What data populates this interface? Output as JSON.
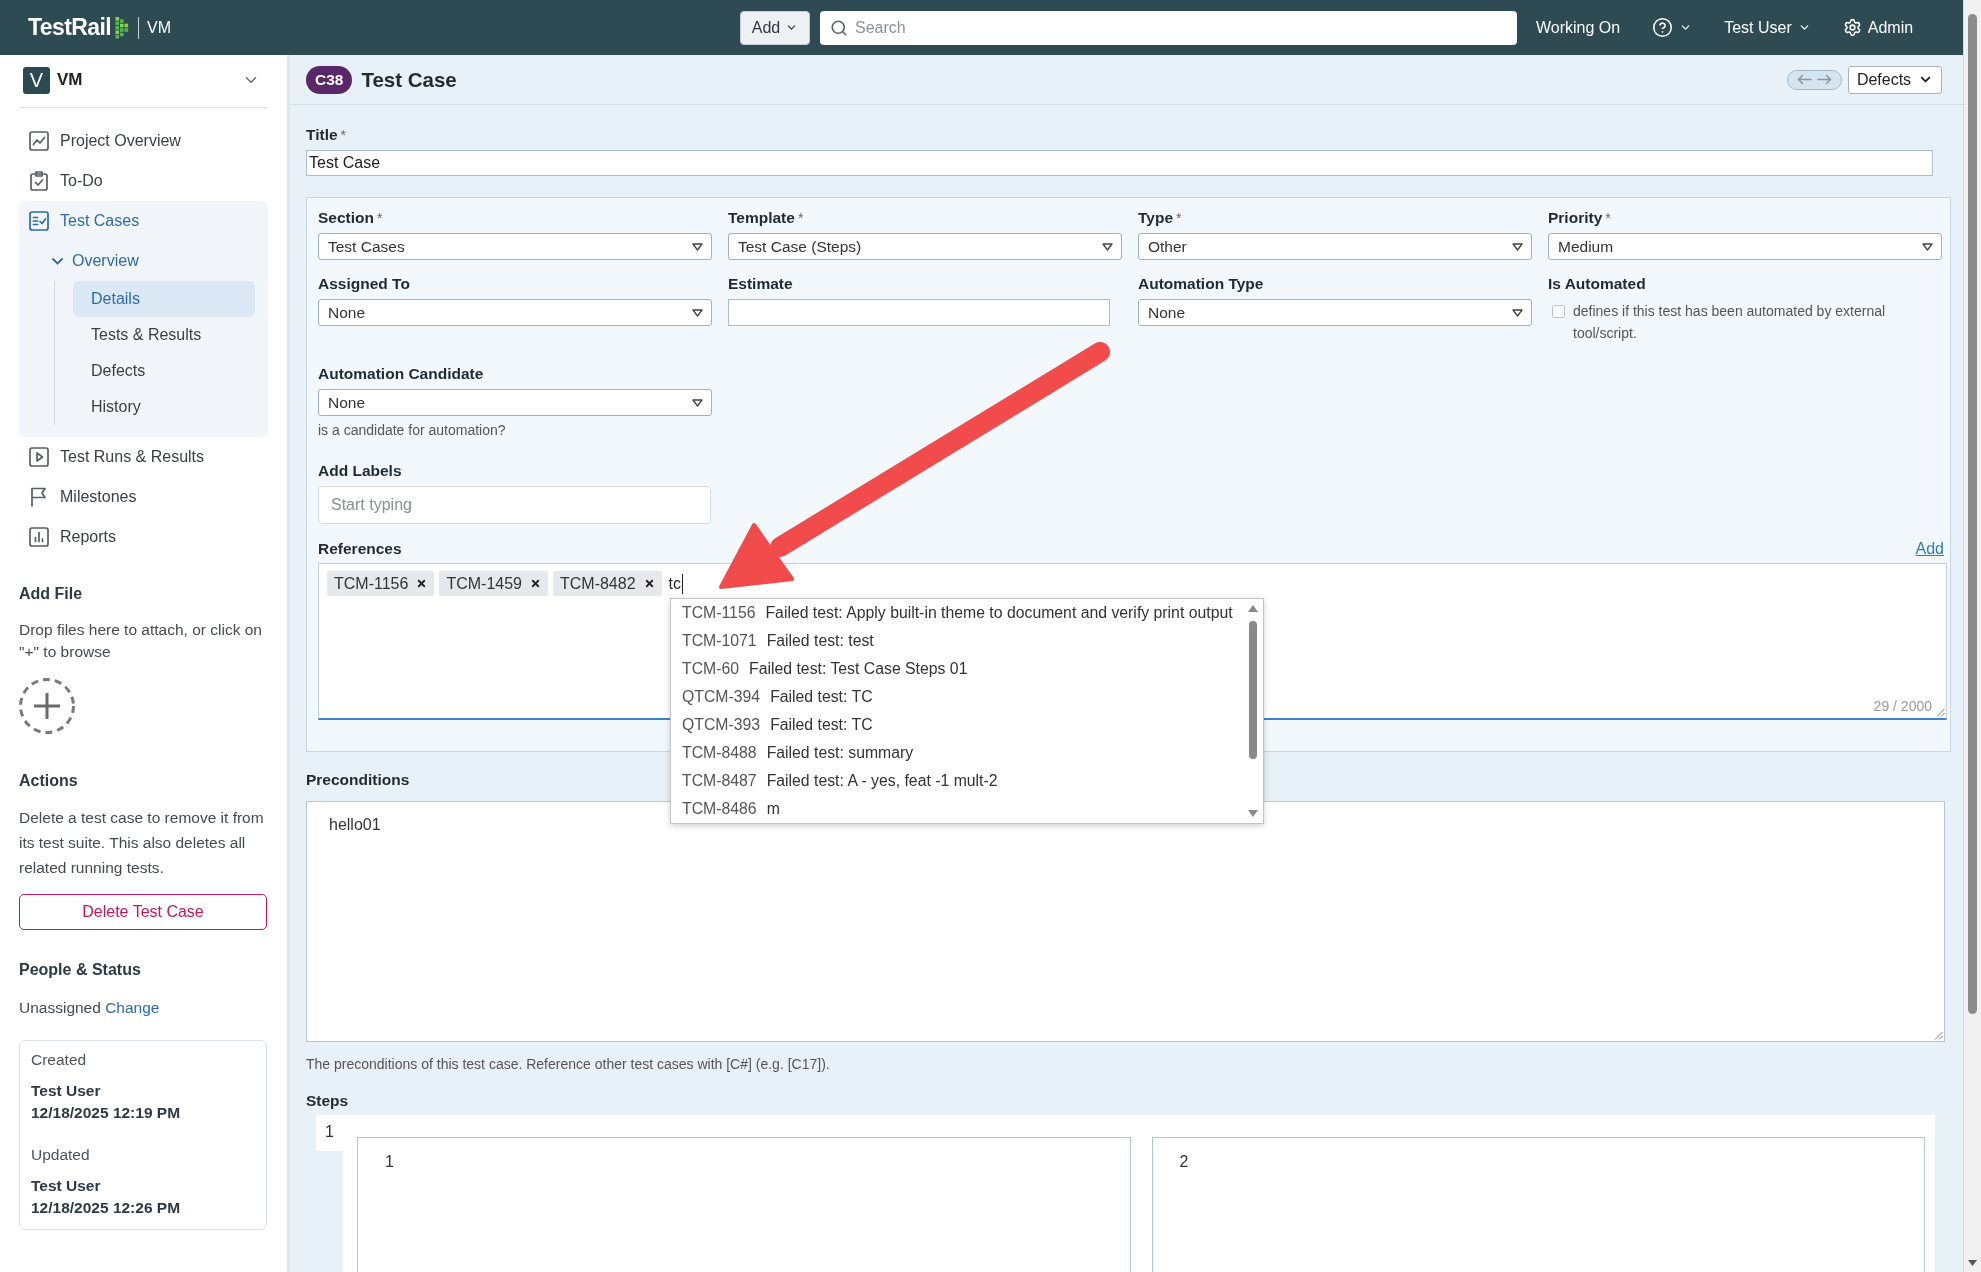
{
  "top_bar": {
    "logo": "TestRail",
    "project": "VM",
    "add_button": "Add",
    "search": {
      "placeholder": "Search"
    },
    "working_on": "Working On",
    "user_menu": "Test User",
    "admin": "Admin"
  },
  "sidebar": {
    "project": {
      "initial": "V",
      "name": "VM"
    },
    "nav": [
      {
        "label": "Project Overview",
        "selected": false
      },
      {
        "label": "To-Do",
        "selected": false
      },
      {
        "label": "Test Cases",
        "selected": true,
        "children": [
          {
            "label": "Overview",
            "selected": true,
            "expanded": true,
            "children": [
              {
                "label": "Details",
                "selected": true
              },
              {
                "label": "Tests & Results",
                "selected": false
              },
              {
                "label": "Defects",
                "selected": false
              },
              {
                "label": "History",
                "selected": false
              }
            ]
          }
        ]
      },
      {
        "label": "Test Runs & Results",
        "selected": false
      },
      {
        "label": "Milestones",
        "selected": false
      },
      {
        "label": "Reports",
        "selected": false
      }
    ],
    "add_file": {
      "heading": "Add File",
      "text": "Drop files here to attach, or click on \"+\" to browse"
    },
    "actions": {
      "heading": "Actions",
      "text": "Delete a test case to remove it from its test suite. This also deletes all related running tests.",
      "button": "Delete Test Case"
    },
    "people_status": {
      "heading": "People & Status",
      "assignee": "Unassigned",
      "change_link": "Change",
      "events": [
        {
          "label": "Created",
          "user": "Test User",
          "time": "12/18/2025 12:19 PM"
        },
        {
          "label": "Updated",
          "user": "Test User",
          "time": "12/18/2025 12:26 PM"
        }
      ]
    }
  },
  "header": {
    "badge": "C38",
    "title": "Test Case",
    "defects_button": "Defects"
  },
  "form": {
    "title": {
      "label": "Title",
      "mark": "*",
      "value": "Test Case"
    },
    "fields": [
      {
        "kind": "select",
        "label": "Section",
        "mark": "*",
        "value": "Test Cases"
      },
      {
        "kind": "select",
        "label": "Template",
        "mark": "*",
        "value": "Test Case (Steps)"
      },
      {
        "kind": "select",
        "label": "Type",
        "mark": "*",
        "value": "Other"
      },
      {
        "kind": "select",
        "label": "Priority",
        "mark": "*",
        "value": "Medium"
      },
      {
        "kind": "select",
        "label": "Assigned To",
        "value": "None"
      },
      {
        "kind": "text",
        "label": "Estimate"
      },
      {
        "kind": "select",
        "label": "Automation Type",
        "value": "None"
      },
      {
        "kind": "checkbox",
        "label": "Is Automated",
        "checked": false,
        "hint": "defines if this test has been automated by external tool/script."
      },
      {
        "kind": "select",
        "label": "Automation Candidate",
        "value": "None",
        "hint": "is a candidate for automation?"
      }
    ],
    "labels": {
      "label": "Add Labels",
      "placeholder": "Start typing"
    },
    "references": {
      "label": "References",
      "add_link": "Add",
      "chips": [
        "TCM-1156",
        "TCM-1459",
        "TCM-8482"
      ],
      "value": "tc",
      "counter": "29 / 2000",
      "suggestions": [
        {
          "id": "TCM-1156",
          "text": "Failed test: Apply built-in theme to document and verify print output"
        },
        {
          "id": "TCM-1071",
          "text": "Failed test: test"
        },
        {
          "id": "TCM-60",
          "text": "Failed test: Test Case Steps 01"
        },
        {
          "id": "QTCM-394",
          "text": "Failed test: TC"
        },
        {
          "id": "QTCM-393",
          "text": "Failed test: TC"
        },
        {
          "id": "TCM-8488",
          "text": "Failed test: summary"
        },
        {
          "id": "TCM-8487",
          "text": "Failed test: A - yes, feat -1 mult-2"
        },
        {
          "id": "TCM-8486",
          "text": "m"
        }
      ]
    },
    "preconditions": {
      "label": "Preconditions",
      "value": "hello01",
      "hint": "The preconditions of this test case. Reference other test cases with [C#] (e.g. [C17])."
    },
    "steps": {
      "label": "Steps",
      "items": [
        {
          "number": "1",
          "fields": [
            "1",
            "2"
          ]
        }
      ]
    }
  }
}
